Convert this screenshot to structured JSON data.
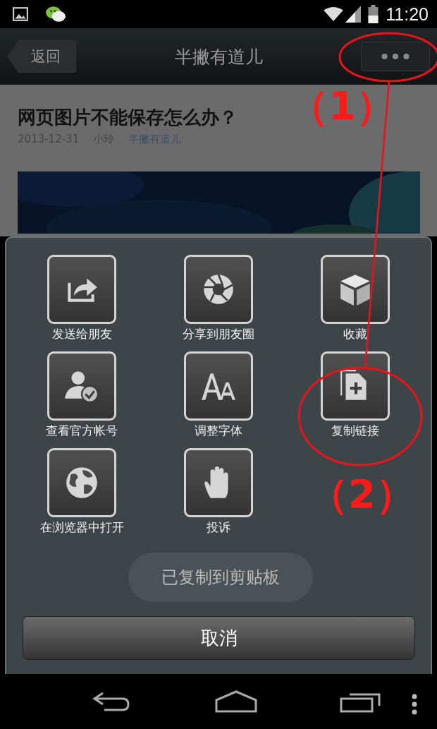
{
  "status_bar": {
    "time": "11:20"
  },
  "nav_bar": {
    "back_label": "返回",
    "title": "半撇有道儿"
  },
  "article": {
    "title": "网页图片不能保存怎么办？",
    "date": "2013-12-31",
    "author": "小玲",
    "account": "半撇有道儿"
  },
  "share_sheet": {
    "items": [
      {
        "label": "发送给朋友"
      },
      {
        "label": "分享到朋友圈"
      },
      {
        "label": "收藏"
      },
      {
        "label": "查看官方帐号"
      },
      {
        "label": "调整字体"
      },
      {
        "label": "复制链接"
      },
      {
        "label": "在浏览器中打开"
      },
      {
        "label": "投诉"
      }
    ],
    "toast": "已复制到剪贴板",
    "cancel_label": "取消"
  },
  "annotations": [
    "（1）",
    "（2）"
  ]
}
